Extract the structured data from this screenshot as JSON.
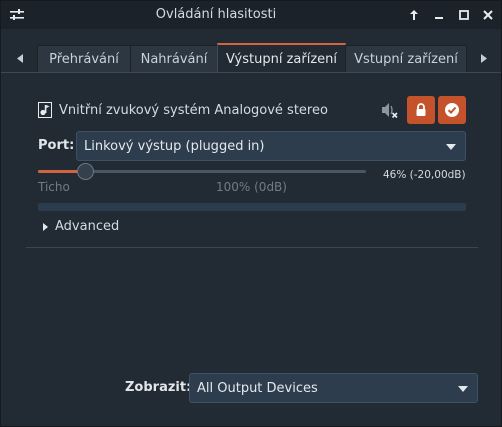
{
  "window": {
    "title": "Ovládání hlasitosti",
    "buttons": [
      "minimize-to-top",
      "restore",
      "maximize",
      "close"
    ]
  },
  "tabs": [
    {
      "label": "Přehrávání",
      "active": false
    },
    {
      "label": "Nahrávání",
      "active": false
    },
    {
      "label": "Výstupní zařízení",
      "active": true
    },
    {
      "label": "Vstupní zařízení",
      "active": false
    }
  ],
  "device": {
    "name": "Vnitřní zvukový systém Analogové stereo",
    "icon": "audio-card-icon"
  },
  "port": {
    "label": "Port:",
    "value": "Linkový výstup (plugged in)"
  },
  "volume": {
    "fraction": 0.46,
    "display": "46% (-20,00dB)",
    "min_label": "Ticho",
    "mid_label": "100% (0dB)"
  },
  "advanced": {
    "label": "Advanced"
  },
  "show": {
    "label": "Zobrazit:",
    "value": "All Output Devices"
  },
  "colors": {
    "accent": "#d0653f",
    "background": "#222b33",
    "select_bg": "#2d3d4e"
  }
}
